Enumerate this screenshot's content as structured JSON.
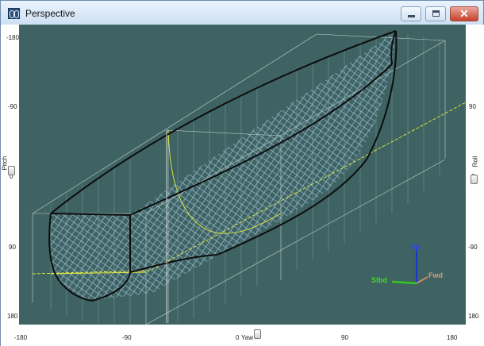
{
  "window": {
    "title": "Perspective",
    "close_glyph": "✕"
  },
  "rulers": {
    "left_ticks": [
      "-180",
      "-90",
      "0",
      "90",
      "180"
    ],
    "left_axis_label": "Pitch",
    "right_ticks": [
      "90",
      "0",
      "-90",
      "180"
    ],
    "right_axis_label": "Roll",
    "bottom_ticks": [
      "-180",
      "-90",
      "0",
      "90",
      "180"
    ],
    "bottom_axis_label": "Yaw"
  },
  "orientation": {
    "up_label": "Up",
    "starboard_label": "Stbd",
    "forward_label": "Fwd"
  },
  "colors": {
    "background": "#3f6362",
    "hull_outline": "#0d0d0d",
    "hull_mesh": "#9fc2de",
    "waterline": "#e8ef3a",
    "box_lines": "#f2f2f2",
    "up_axis": "#1a36c8",
    "starboard_axis": "#34c81d",
    "forward_axis": "#c98a6a"
  }
}
